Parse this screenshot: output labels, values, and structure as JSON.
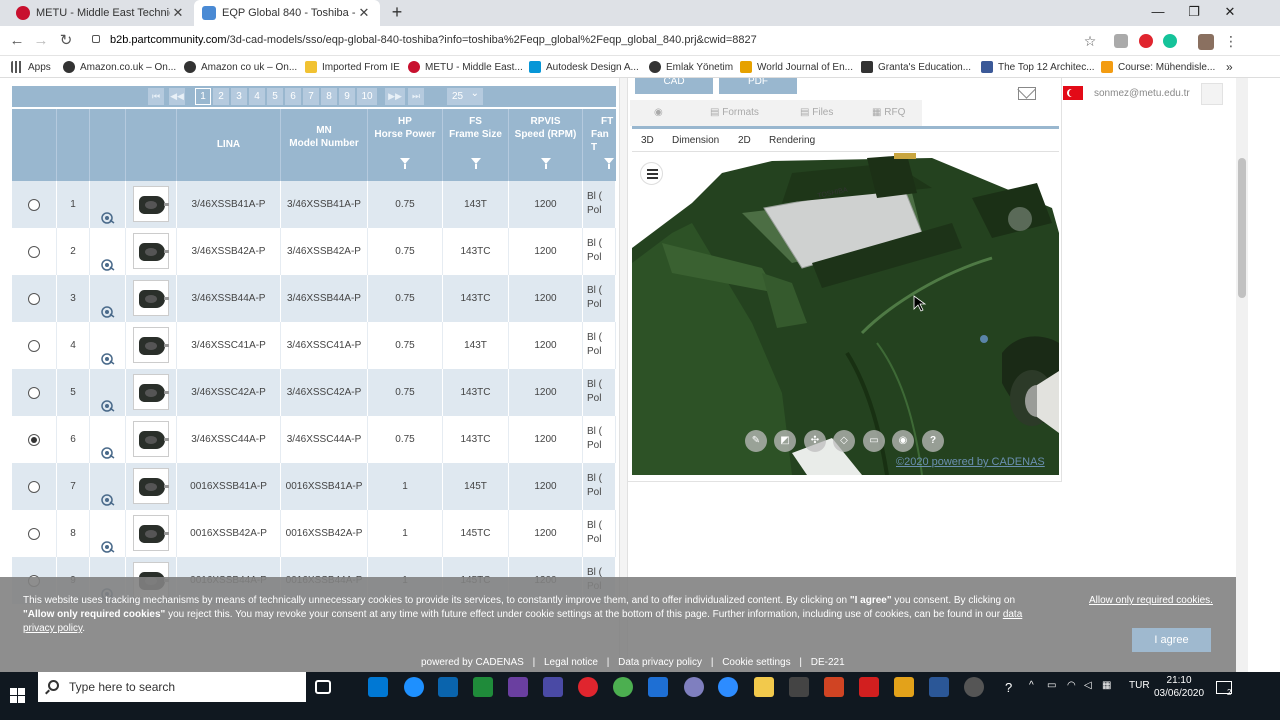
{
  "browser": {
    "tabs": [
      {
        "title": "METU - Middle East Technical Ur",
        "close": "✕",
        "favicon_color": "#c8102e"
      },
      {
        "title": "EQP Global 840 - Toshiba - Free",
        "close": "✕",
        "favicon_color": "#4a8ad4"
      }
    ],
    "new_tab": "+",
    "window_controls": {
      "minimize": "—",
      "maximize": "❐",
      "close": "✕"
    },
    "url_domain": "b2b.partcommunity.com",
    "url_path": "/3d-cad-models/sso/eqp-global-840-toshiba?info=toshiba%2Feqp_global%2Feqp_global_840.prj&cwid=8827",
    "bookmarks": [
      {
        "label": "Apps",
        "color": "#555"
      },
      {
        "label": "Amazon.co.uk – On...",
        "color": "#333"
      },
      {
        "label": "Amazon co uk – On...",
        "color": "#333"
      },
      {
        "label": "Imported From IE",
        "color": "#f1c232"
      },
      {
        "label": "METU - Middle East...",
        "color": "#c8102e"
      },
      {
        "label": "Autodesk Design A...",
        "color": "#0696d7"
      },
      {
        "label": "Emlak Yönetim",
        "color": "#333"
      },
      {
        "label": "World Journal of En...",
        "color": "#e6a100"
      },
      {
        "label": "Granta's Education...",
        "color": "#333"
      },
      {
        "label": "The Top 12 Architec...",
        "color": "#3b5998"
      },
      {
        "label": "Course: Mühendisle...",
        "color": "#f39c12"
      }
    ],
    "more_bookmarks": "»"
  },
  "pager": {
    "nav_first": "⏮",
    "nav_prev": "◀◀",
    "pages": [
      "1",
      "2",
      "3",
      "4",
      "5",
      "6",
      "7",
      "8",
      "9",
      "10"
    ],
    "current_page": "1",
    "nav_next": "▶▶",
    "nav_last": "⏭",
    "per_page": "25",
    "per_page_caret": "⌄"
  },
  "table": {
    "columns": [
      {
        "line1": "",
        "line2": "",
        "filter": false
      },
      {
        "line1": "",
        "line2": "",
        "filter": false
      },
      {
        "line1": "",
        "line2": "",
        "filter": false
      },
      {
        "line1": "",
        "line2": "",
        "filter": false
      },
      {
        "line1": "LINA",
        "line2": "",
        "filter": false
      },
      {
        "line1": "MN",
        "line2": "Model Number",
        "filter": false
      },
      {
        "line1": "HP",
        "line2": "Horse Power",
        "filter": true
      },
      {
        "line1": "FS",
        "line2": "Frame Size",
        "filter": true
      },
      {
        "line1": "RPVIS",
        "line2": "Speed (RPM)",
        "filter": true
      },
      {
        "line1": "FT",
        "line2": "Fan T",
        "filter": true
      }
    ],
    "rows": [
      {
        "num": "1",
        "lina": "3/46XSSB41A-P",
        "mn": "3/46XSSB41A-P",
        "hp": "0.75",
        "fs": "143T",
        "rpm": "1200",
        "ft1": "Bl (",
        "ft2": "Pol",
        "selected": false
      },
      {
        "num": "2",
        "lina": "3/46XSSB42A-P",
        "mn": "3/46XSSB42A-P",
        "hp": "0.75",
        "fs": "143TC",
        "rpm": "1200",
        "ft1": "Bl (",
        "ft2": "Pol",
        "selected": false
      },
      {
        "num": "3",
        "lina": "3/46XSSB44A-P",
        "mn": "3/46XSSB44A-P",
        "hp": "0.75",
        "fs": "143TC",
        "rpm": "1200",
        "ft1": "Bl (",
        "ft2": "Pol",
        "selected": false
      },
      {
        "num": "4",
        "lina": "3/46XSSC41A-P",
        "mn": "3/46XSSC41A-P",
        "hp": "0.75",
        "fs": "143T",
        "rpm": "1200",
        "ft1": "Bl (",
        "ft2": "Pol",
        "selected": false
      },
      {
        "num": "5",
        "lina": "3/46XSSC42A-P",
        "mn": "3/46XSSC42A-P",
        "hp": "0.75",
        "fs": "143TC",
        "rpm": "1200",
        "ft1": "Bl (",
        "ft2": "Pol",
        "selected": false
      },
      {
        "num": "6",
        "lina": "3/46XSSC44A-P",
        "mn": "3/46XSSC44A-P",
        "hp": "0.75",
        "fs": "143TC",
        "rpm": "1200",
        "ft1": "Bl (",
        "ft2": "Pol",
        "selected": true
      },
      {
        "num": "7",
        "lina": "0016XSSB41A-P",
        "mn": "0016XSSB41A-P",
        "hp": "1",
        "fs": "145T",
        "rpm": "1200",
        "ft1": "Bl (",
        "ft2": "Pol",
        "selected": false
      },
      {
        "num": "8",
        "lina": "0016XSSB42A-P",
        "mn": "0016XSSB42A-P",
        "hp": "1",
        "fs": "145TC",
        "rpm": "1200",
        "ft1": "Bl (",
        "ft2": "Pol",
        "selected": false
      },
      {
        "num": "9",
        "lina": "0016XSSB44A-P",
        "mn": "0016XSSB44A-P",
        "hp": "1",
        "fs": "145TC",
        "rpm": "1200",
        "ft1": "Bl (",
        "ft2": "Pol",
        "selected": false
      }
    ]
  },
  "viewer": {
    "top_buttons": [
      "CAD",
      "PDF"
    ],
    "section_tabs": [
      "Formats",
      "Files",
      "RFQ"
    ],
    "view_tabs": [
      "3D",
      "Dimension",
      "2D",
      "Rendering"
    ],
    "tools": [
      "✎",
      "◩",
      "✣",
      "◇",
      "▭",
      "◉",
      "?"
    ],
    "powered": "©2020 powered by CADENAS",
    "user_email": "sonmez@metu.edu.tr"
  },
  "cookie": {
    "text_1": "This website uses tracking mechanisms by means of technically unnecessary cookies to provide its services, to constantly improve them, and to offer individualized content. By clicking on ",
    "bold_1": "\"I agree\"",
    "text_2": " you consent. By clicking on ",
    "bold_2": "\"Allow only required cookies\"",
    "text_3": " you reject this. You may revoke your consent at any time with future effect under cookie settings at the bottom of this page. Further information, including use of cookies, can be found in our ",
    "link": "data privacy policy",
    "text_4": ".",
    "allow_required": "Allow only required cookies.",
    "agree": "I agree"
  },
  "footer": {
    "items": [
      "powered by CADENAS",
      "|",
      "Legal notice",
      "|",
      "Data privacy policy",
      "|",
      "Cookie settings",
      "|",
      "DE-221"
    ]
  },
  "taskbar": {
    "search_placeholder": "Type here to search",
    "language": "TUR",
    "time": "21:10",
    "date": "03/06/2020",
    "notification_count": "2"
  }
}
